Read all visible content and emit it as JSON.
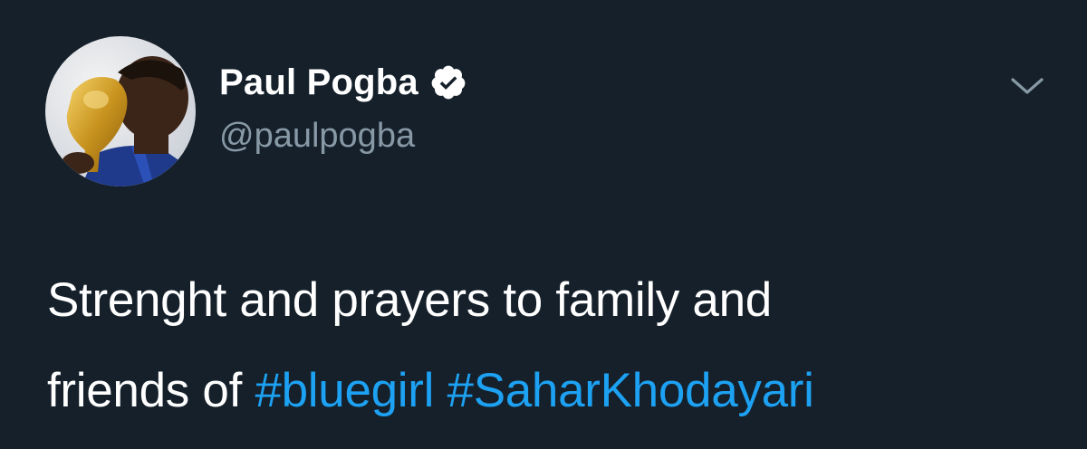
{
  "author": {
    "display_name": "Paul Pogba",
    "handle": "@paulpogba",
    "verified": true
  },
  "icons": {
    "verified": "verified-badge-icon",
    "menu": "chevron-down-icon"
  },
  "tweet": {
    "line1": "Strenght and prayers to family and",
    "line2_prefix": "friends of ",
    "hashtags": [
      "#bluegirl",
      "#SaharKhodayari"
    ]
  },
  "colors": {
    "background": "#15202b",
    "text": "#ffffff",
    "secondary": "#8899a6",
    "link": "#1da1f2"
  }
}
